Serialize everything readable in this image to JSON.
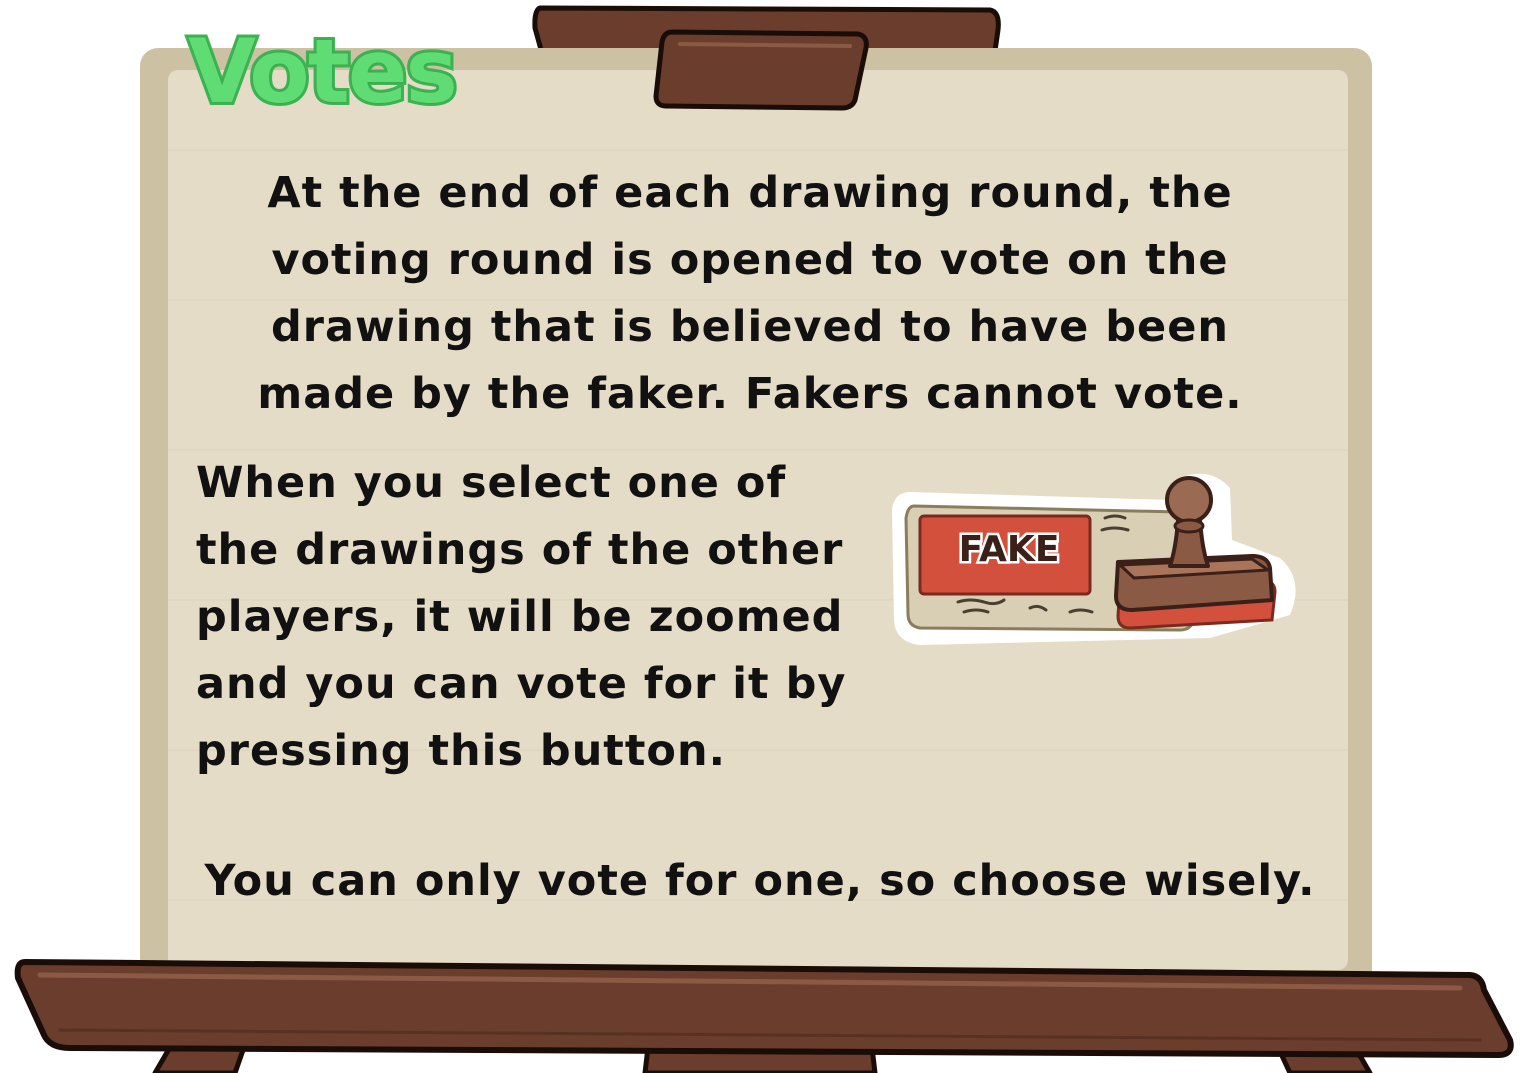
{
  "board": {
    "title": "Votes",
    "paragraph_1": "At the end of each drawing round, the\nvoting round is opened to vote on the\ndrawing that is believed to have been\nmade by the faker. Fakers cannot vote.",
    "paragraph_2": "When you select one of\nthe drawings of the other\nplayers, it will be zoomed\nand you can vote for it by\npressing this button.",
    "paragraph_3": "You can only vote for one, so choose wisely."
  },
  "vote_button": {
    "label": "FAKE",
    "icon": "fake-stamp-icon"
  },
  "colors": {
    "title_green": "#5fdc73",
    "board_paper": "#e4dcc6",
    "board_frame": "#cdc1a3",
    "wood": "#6b3d2c",
    "stamp_red": "#d2503c"
  }
}
